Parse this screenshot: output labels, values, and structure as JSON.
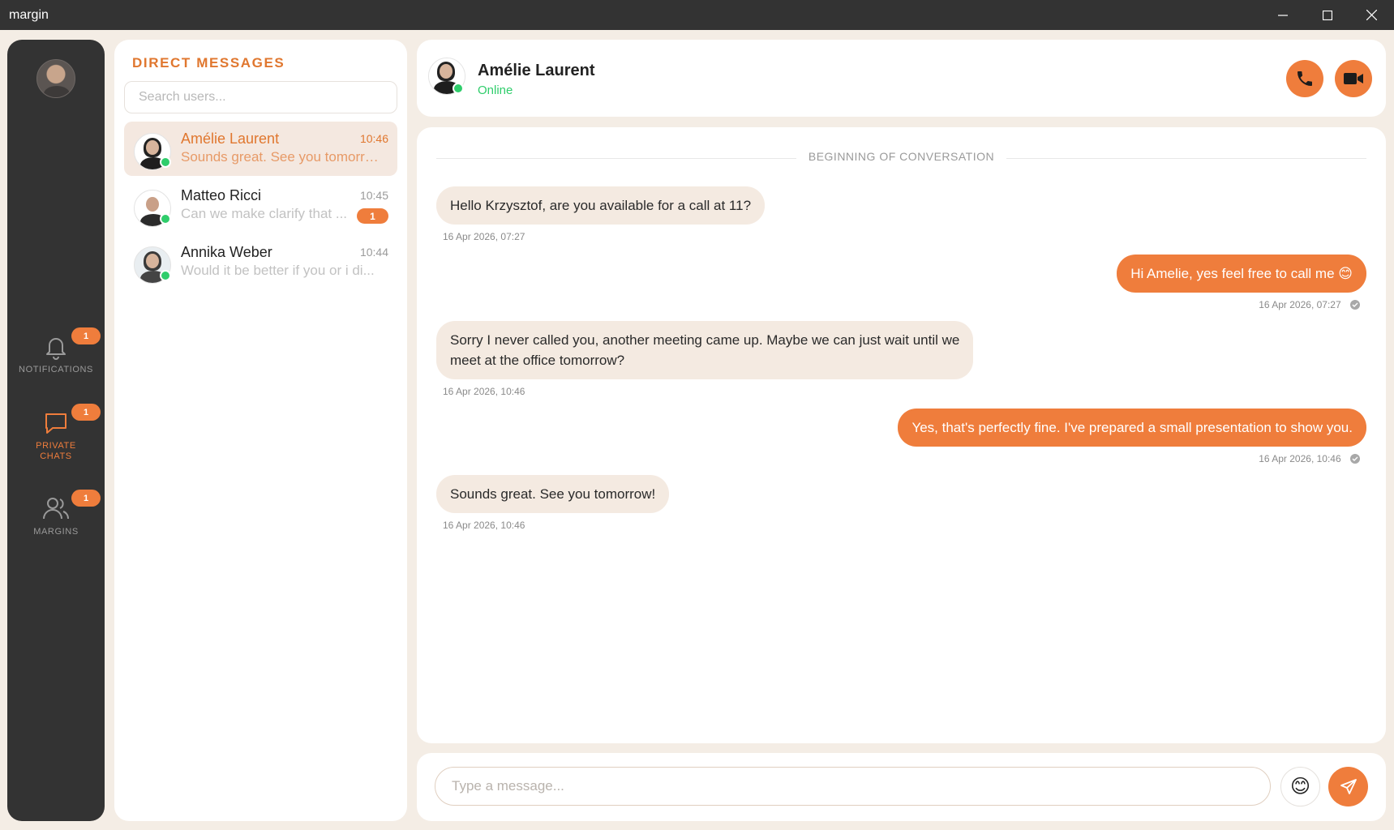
{
  "window": {
    "title": "margin"
  },
  "nav": {
    "items": [
      {
        "label": "NOTIFICATIONS",
        "icon": "bell-icon",
        "badge": "1",
        "active": false
      },
      {
        "label": "PRIVATE CHATS",
        "icon": "chat-bubble-icon",
        "badge": "1",
        "active": true
      },
      {
        "label": "MARGINS",
        "icon": "users-icon",
        "badge": "1",
        "active": false
      }
    ]
  },
  "dm": {
    "title": "DIRECT MESSAGES",
    "search_placeholder": "Search users...",
    "conversations": [
      {
        "name": "Amélie Laurent",
        "time": "10:46",
        "preview": "Sounds great. See you tomorrow!",
        "online": true,
        "unread": ""
      },
      {
        "name": "Matteo Ricci",
        "time": "10:45",
        "preview": "Can we make clarify that ...",
        "online": true,
        "unread": "1"
      },
      {
        "name": "Annika Weber",
        "time": "10:44",
        "preview": "Would it be better if you or i di...",
        "online": true,
        "unread": ""
      }
    ]
  },
  "chat": {
    "contact_name": "Amélie Laurent",
    "status": "Online",
    "separator": "BEGINNING OF CONVERSATION",
    "messages": [
      {
        "direction": "in",
        "text": "Hello Krzysztof, are you available for a call at 11?",
        "timestamp": "16 Apr 2026, 07:27"
      },
      {
        "direction": "out",
        "text": "Hi Amelie, yes feel free to call me 😊",
        "timestamp": "16 Apr 2026, 07:27"
      },
      {
        "direction": "in",
        "text": "Sorry I never called you, another meeting came up. Maybe we can just wait until we",
        "text2": "meet at the office tomorrow?",
        "timestamp": "16 Apr 2026, 10:46"
      },
      {
        "direction": "out",
        "text": "Yes, that's perfectly fine. I've prepared a small presentation to show you.",
        "timestamp": "16 Apr 2026, 10:46"
      },
      {
        "direction": "in",
        "text": "Sounds great. See you tomorrow!",
        "timestamp": "16 Apr 2026, 10:46"
      }
    ]
  },
  "composer": {
    "placeholder": "Type a message...",
    "emoji": "😊"
  },
  "colors": {
    "accent": "#ef7d3c",
    "online": "#2fcd6b",
    "rail": "#333333"
  }
}
